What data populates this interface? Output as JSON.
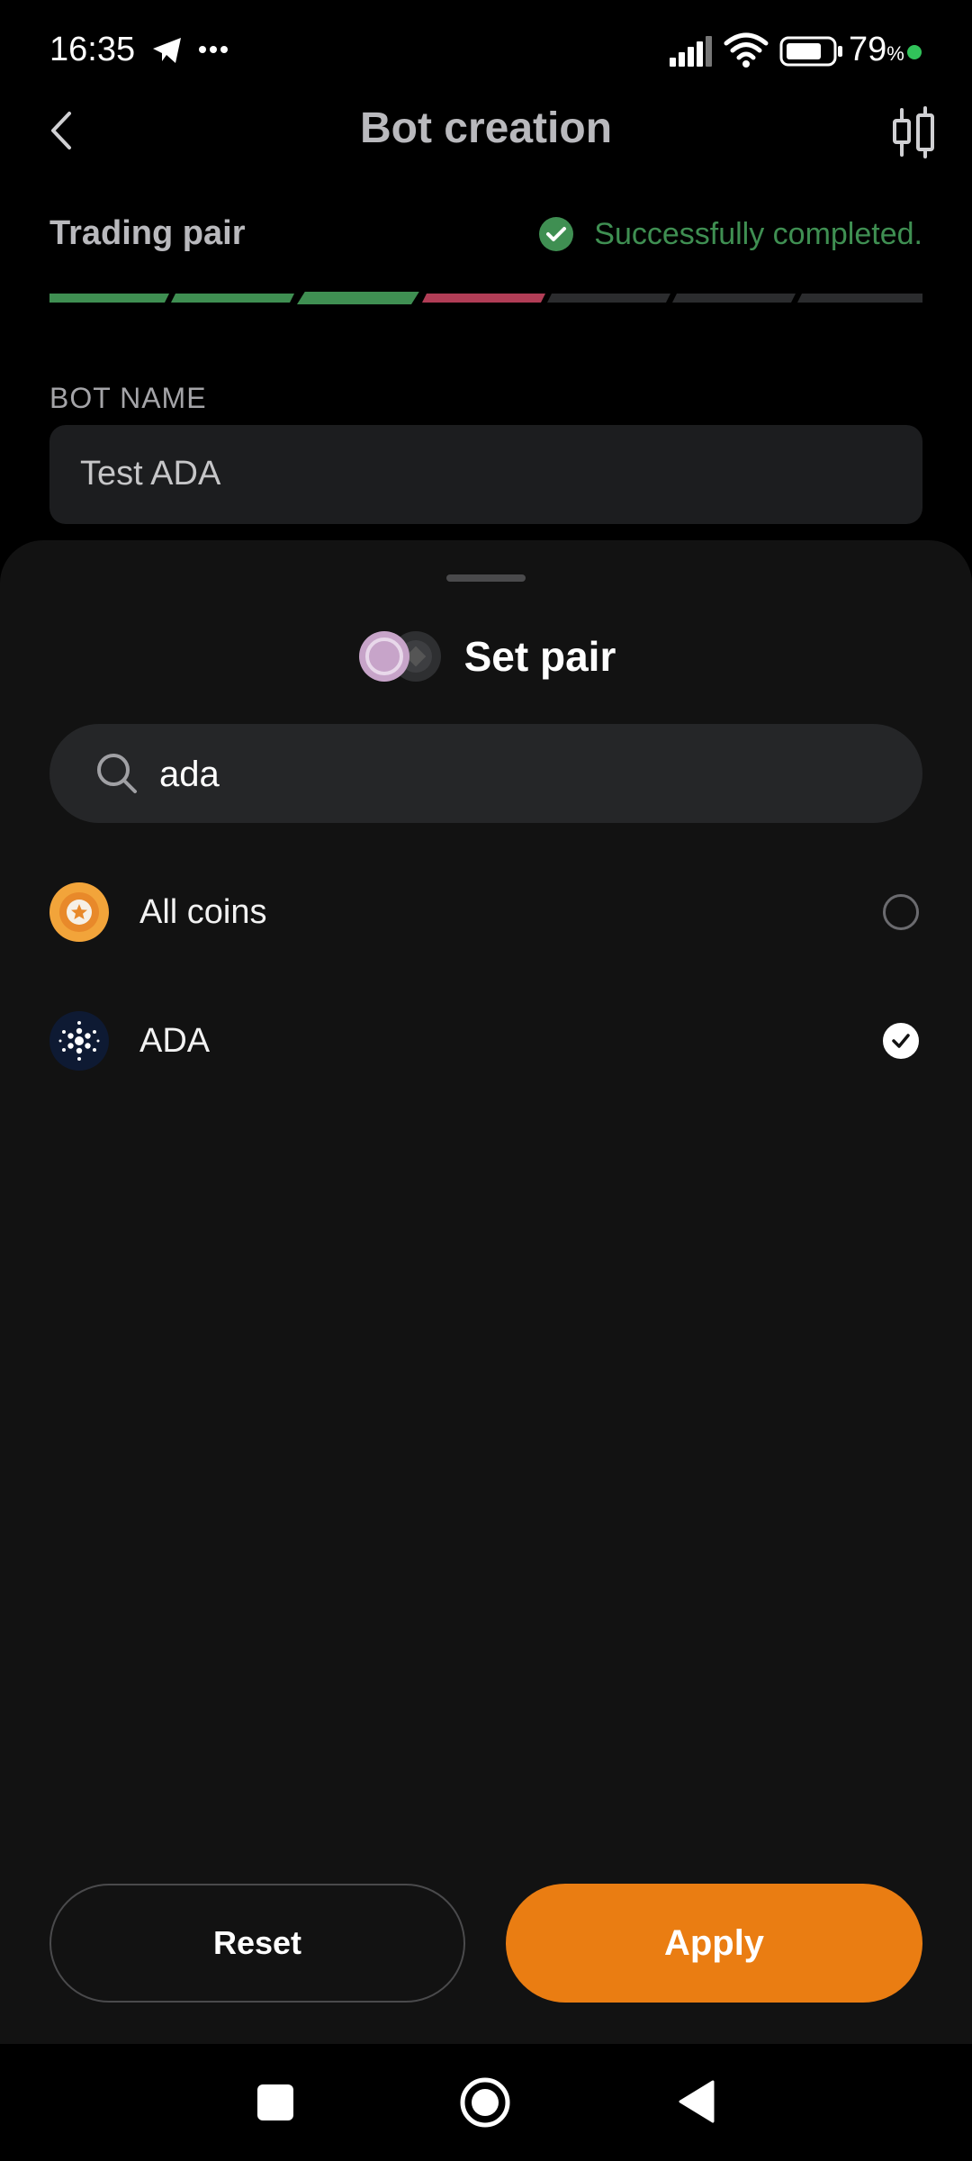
{
  "status_bar": {
    "time": "16:35",
    "battery_percent": "79",
    "battery_unit": "%",
    "icons": [
      "telegram-icon",
      "more-dots-icon",
      "signal-icon",
      "wifi-icon",
      "battery-icon",
      "status-dot"
    ]
  },
  "header": {
    "title": "Bot creation",
    "back_icon": "chevron-left-icon",
    "chart_icon": "candlestick-icon"
  },
  "step": {
    "label": "Trading pair",
    "status_text": "Successfully completed.",
    "progress_segments": [
      "complete",
      "complete",
      "current",
      "warning",
      "pending",
      "pending",
      "pending"
    ]
  },
  "bot_name": {
    "label": "BOT NAME",
    "value": "Test ADA"
  },
  "sheet": {
    "title": "Set pair",
    "search_value": "ada",
    "items": [
      {
        "label": "All coins",
        "icon": "all-coins-icon",
        "selected": false
      },
      {
        "label": "ADA",
        "icon": "cardano-icon",
        "selected": true
      }
    ],
    "reset_label": "Reset",
    "apply_label": "Apply"
  },
  "colors": {
    "accent": "#ea7d12",
    "success": "#3f8f52",
    "warning": "#b13d56",
    "sheet_bg": "#121212"
  }
}
